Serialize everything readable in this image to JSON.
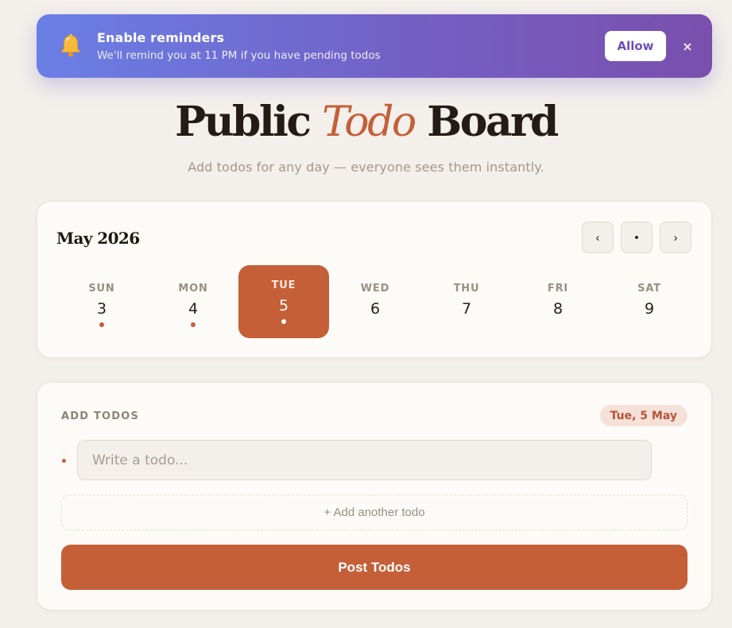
{
  "banner": {
    "icon": "bell-icon",
    "title": "Enable reminders",
    "subtitle": "We'll remind you at 11 PM if you have pending todos",
    "allow_label": "Allow",
    "close_label": "×"
  },
  "header": {
    "title_part1": "Public ",
    "title_accent": "Todo",
    "title_part2": " Board",
    "subtitle": "Add todos for any day — everyone sees them instantly."
  },
  "calendar": {
    "month_label": "May 2026",
    "nav": {
      "prev": "‹",
      "today": "•",
      "next": "›"
    },
    "days": [
      {
        "name": "SUN",
        "num": "3",
        "has_todos": true,
        "selected": false
      },
      {
        "name": "MON",
        "num": "4",
        "has_todos": true,
        "selected": false
      },
      {
        "name": "TUE",
        "num": "5",
        "has_todos": true,
        "selected": true
      },
      {
        "name": "WED",
        "num": "6",
        "has_todos": false,
        "selected": false
      },
      {
        "name": "THU",
        "num": "7",
        "has_todos": false,
        "selected": false
      },
      {
        "name": "FRI",
        "num": "8",
        "has_todos": false,
        "selected": false
      },
      {
        "name": "SAT",
        "num": "9",
        "has_todos": false,
        "selected": false
      }
    ]
  },
  "todos": {
    "section_label": "ADD TODOS",
    "date_badge": "Tue, 5 May",
    "input_placeholder": "Write a todo...",
    "input_value": "",
    "add_another_label": "+ Add another todo",
    "post_label": "Post Todos"
  },
  "colors": {
    "accent": "#c45f38",
    "background": "#f3efea",
    "banner_start": "#6a7fe6",
    "banner_end": "#7a4fae"
  }
}
